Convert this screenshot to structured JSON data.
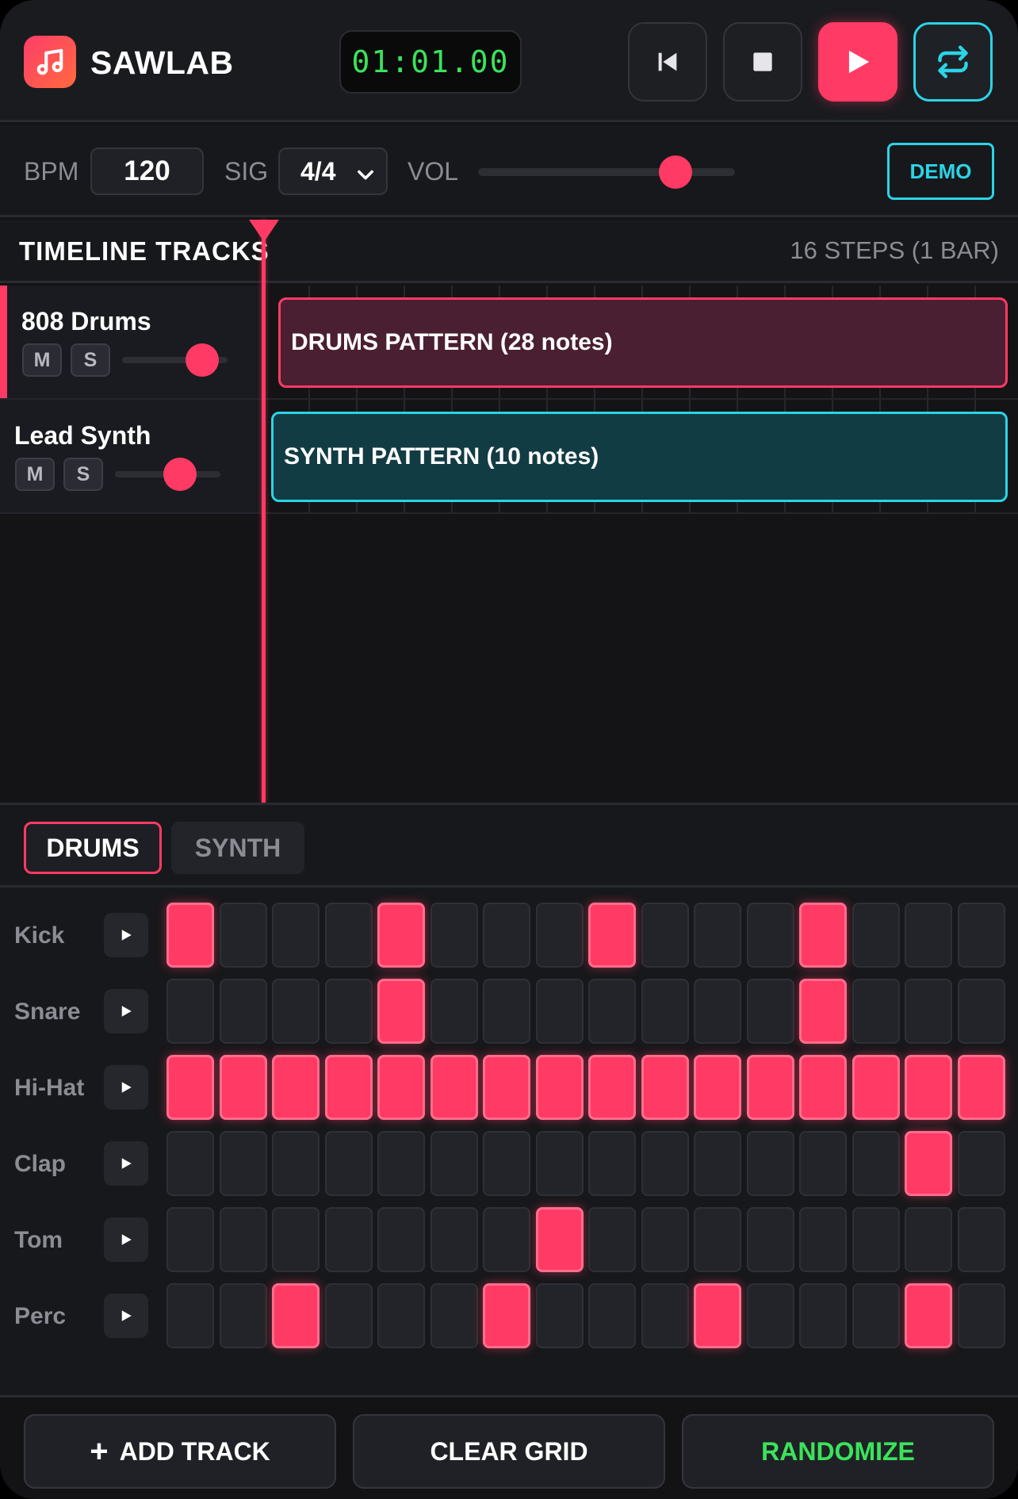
{
  "header": {
    "app_name": "SAWLAB",
    "timer": "01:01.00",
    "accent": "#ff3a64",
    "icons": [
      "music-note-icon",
      "skip-back-icon",
      "stop-icon",
      "play-icon",
      "loop-icon"
    ]
  },
  "controls": {
    "bpm_label": "BPM",
    "bpm_value": "120",
    "sig_label": "SIG",
    "sig_value": "4/4",
    "vol_label": "VOL",
    "vol_level": 0.77,
    "demo_label": "DEMO"
  },
  "timeline": {
    "title": "TIMELINE TRACKS",
    "steps_info": "16 STEPS (1 BAR)",
    "tracks": [
      {
        "name": "808 Drums",
        "mute": "M",
        "solo": "S",
        "volume": 0.75,
        "clip": "DRUMS PATTERN (28 notes)",
        "color": "#ff3a64"
      },
      {
        "name": "Lead Synth",
        "mute": "M",
        "solo": "S",
        "volume": 0.62,
        "clip": "SYNTH PATTERN (10 notes)",
        "color": "#2bd4e6"
      }
    ]
  },
  "sequencer": {
    "tabs": [
      "DRUMS",
      "SYNTH"
    ],
    "active_tab": "DRUMS",
    "rows": [
      {
        "label": "Kick",
        "steps": [
          1,
          0,
          0,
          0,
          1,
          0,
          0,
          0,
          1,
          0,
          0,
          0,
          1,
          0,
          0,
          0
        ]
      },
      {
        "label": "Snare",
        "steps": [
          0,
          0,
          0,
          0,
          1,
          0,
          0,
          0,
          0,
          0,
          0,
          0,
          1,
          0,
          0,
          0
        ]
      },
      {
        "label": "Hi-Hat",
        "steps": [
          1,
          1,
          1,
          1,
          1,
          1,
          1,
          1,
          1,
          1,
          1,
          1,
          1,
          1,
          1,
          1
        ]
      },
      {
        "label": "Clap",
        "steps": [
          0,
          0,
          0,
          0,
          0,
          0,
          0,
          0,
          0,
          0,
          0,
          0,
          0,
          0,
          1,
          0
        ]
      },
      {
        "label": "Tom",
        "steps": [
          0,
          0,
          0,
          0,
          0,
          0,
          0,
          1,
          0,
          0,
          0,
          0,
          0,
          0,
          0,
          0
        ]
      },
      {
        "label": "Perc",
        "steps": [
          0,
          0,
          1,
          0,
          0,
          0,
          1,
          0,
          0,
          0,
          1,
          0,
          0,
          0,
          1,
          0
        ]
      }
    ]
  },
  "footer": {
    "add_track": "ADD TRACK",
    "clear_grid": "CLEAR GRID",
    "randomize": "RANDOMIZE"
  }
}
